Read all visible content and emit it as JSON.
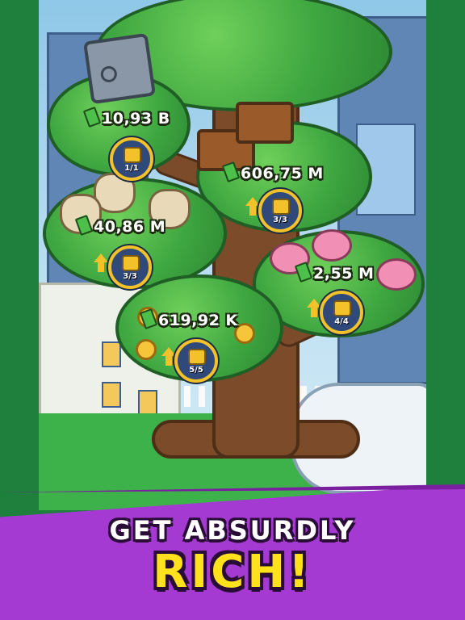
{
  "nodes": [
    {
      "value": "10,93 B",
      "level": "1/1",
      "upgradable": false,
      "icon": "vault-icon"
    },
    {
      "value": "606,75 M",
      "level": "3/3",
      "upgradable": true,
      "icon": "treasure-chest-icon"
    },
    {
      "value": "40,86 M",
      "level": "3/3",
      "upgradable": true,
      "icon": "money-bag-icon"
    },
    {
      "value": "2,55 M",
      "level": "4/4",
      "upgradable": true,
      "icon": "piggy-bank-icon"
    },
    {
      "value": "619,92 K",
      "level": "5/5",
      "upgradable": true,
      "icon": "coin-icon"
    }
  ],
  "tagline": {
    "line1": "GET ABSURDLY",
    "line2": "RICH!"
  },
  "colors": {
    "banner": "#a43ad2",
    "accent": "#ffe21c",
    "frame": "#1f7f3c"
  }
}
